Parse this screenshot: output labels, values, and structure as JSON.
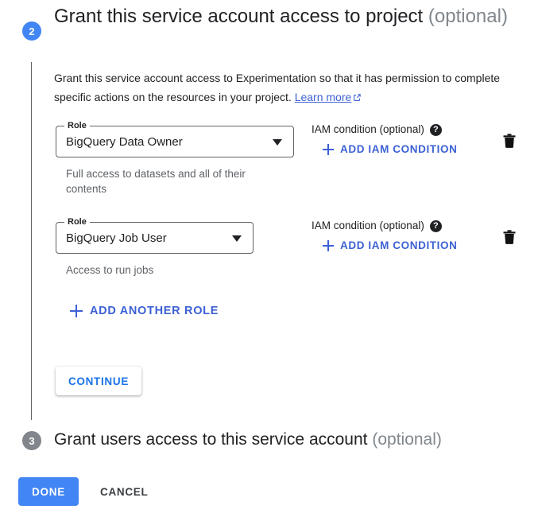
{
  "step2": {
    "number": "2",
    "title": "Grant this service account access to project",
    "optional_suffix": "(optional)",
    "description_part1": "Grant this service account access to Experimentation so that it has permission to complete specific actions on the resources in your project.",
    "learn_more_label": "Learn more",
    "learn_more_icon": "open-in-new-icon",
    "roles": [
      {
        "field_label": "Role",
        "value": "BigQuery Data Owner",
        "help_text": "Full access to datasets and all of their contents",
        "iam_condition_label": "IAM condition (optional)",
        "iam_help_icon": "help-circle-icon",
        "add_condition_label": "ADD IAM CONDITION",
        "delete_icon": "trash-icon"
      },
      {
        "field_label": "Role",
        "value": "BigQuery Job User",
        "help_text": "Access to run jobs",
        "iam_condition_label": "IAM condition (optional)",
        "iam_help_icon": "help-circle-icon",
        "add_condition_label": "ADD IAM CONDITION",
        "delete_icon": "trash-icon"
      }
    ],
    "add_another_role_label": "ADD ANOTHER ROLE",
    "continue_label": "CONTINUE"
  },
  "step3": {
    "number": "3",
    "title": "Grant users access to this service account",
    "optional_suffix": "(optional)"
  },
  "footer": {
    "done_label": "DONE",
    "cancel_label": "CANCEL"
  },
  "colors": {
    "active_step_badge": "#4285f4",
    "inactive_step_badge": "#80868b",
    "link_blue": "#3c61d4",
    "primary_button": "#4285f4",
    "text_primary": "#202124",
    "text_secondary": "#5f6368"
  }
}
